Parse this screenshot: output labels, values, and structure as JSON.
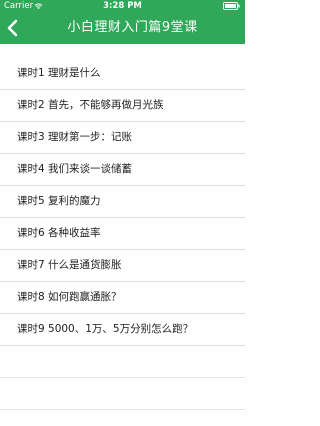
{
  "status_bar": {
    "carrier": "Carrier",
    "time": "3:28 PM"
  },
  "nav": {
    "title": "小白理财入门篇9堂课",
    "back_icon": "chevron-left-icon"
  },
  "colors": {
    "header": "#2fa85a",
    "divider": "#dcdcdc",
    "text": "#222222"
  },
  "lessons": [
    {
      "label": "课时1 理财是什么"
    },
    {
      "label": "课时2 首先，不能够再做月光族"
    },
    {
      "label": "课时3 理财第一步：记账"
    },
    {
      "label": "课时4 我们来谈一谈储蓄"
    },
    {
      "label": "课时5 复利的魔力"
    },
    {
      "label": "课时6 各种收益率"
    },
    {
      "label": "课时7 什么是通货膨胀"
    },
    {
      "label": "课时8 如何跑赢通胀？"
    },
    {
      "label": "课时9 5000、1万、5万分别怎么跑？"
    }
  ]
}
